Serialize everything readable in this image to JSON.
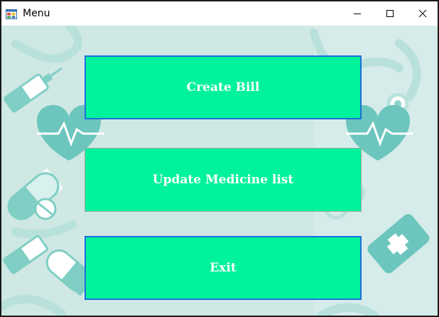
{
  "window": {
    "title": "Menu",
    "app_icon": "windows-form-icon",
    "controls": {
      "minimize_icon": "minimize-icon",
      "maximize_icon": "maximize-icon",
      "close_icon": "close-icon"
    }
  },
  "background": {
    "theme": "medical pattern",
    "base_color": "#cfe8e4",
    "accent_color": "#6cc6bd",
    "icons": [
      "syringe-icon",
      "heart-pulse-icon",
      "pill-icon",
      "stethoscope-icon",
      "medicine-bottle-icon"
    ]
  },
  "menu": {
    "buttons": [
      {
        "label": "Create Bill"
      },
      {
        "label": "Update Medicine list"
      },
      {
        "label": "Exit"
      }
    ],
    "button_color": "#00f29c",
    "button_text_color": "#ffffff",
    "focus_border_color": "#1e6fd9"
  }
}
